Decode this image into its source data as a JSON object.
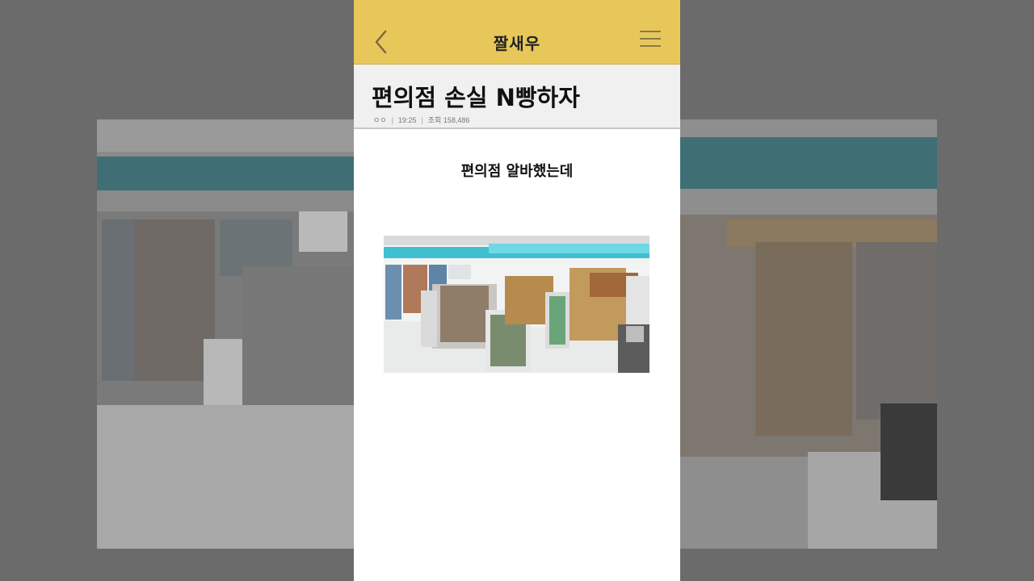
{
  "app": {
    "title": "짤새우"
  },
  "post": {
    "title": "편의점 손실 N빵하자",
    "author": "ㅇㅇ",
    "time": "19:25",
    "views_label": "조회",
    "views": "158,486",
    "body_text": "편의점 알바했는데"
  },
  "icons": {
    "back": "back-chevron-icon",
    "menu": "hamburger-menu-icon"
  },
  "colors": {
    "topbar": "#e8c75a",
    "header_bg": "#f0f0f0",
    "backdrop": "#6b6b6b"
  }
}
